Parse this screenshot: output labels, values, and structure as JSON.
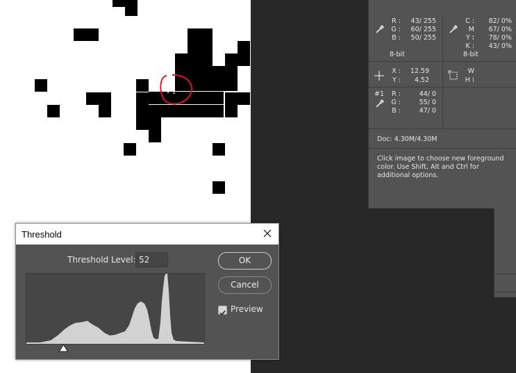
{
  "canvas": {
    "background": "#ffffff",
    "pixel_color": "#000000",
    "marker_color": "#e0141e"
  },
  "info_panel": {
    "rgb_primary": {
      "labels": [
        "R :",
        "G :",
        "B :"
      ],
      "values": [
        "43/  255",
        "60/  255",
        "50/  255"
      ],
      "bit": "8-bit"
    },
    "cmyk": {
      "labels": [
        "C :",
        "M :",
        "Y :",
        "K :"
      ],
      "values": [
        "82/    0%",
        "67/    0%",
        "78/    0%",
        "43/    0%"
      ],
      "bit": "8-bit"
    },
    "position": {
      "labels": [
        "X :",
        "Y :"
      ],
      "values": [
        "12.59",
        "4.52"
      ]
    },
    "size": {
      "labels": [
        "W :",
        "H :"
      ]
    },
    "sampler": {
      "id": "#1",
      "labels": [
        "R :",
        "G :",
        "B :"
      ],
      "values": [
        "44/    0",
        "55/    0",
        "47/    0"
      ]
    },
    "doc": "Doc: 4.30M/4.30M",
    "help": "Click image to choose new foreground color.  Use Shift, Alt and Ctrl for additional options."
  },
  "dialog": {
    "title": "Threshold",
    "threshold_label": "Threshold Level:",
    "threshold_value": "52",
    "ok_label": "OK",
    "cancel_label": "Cancel",
    "preview_label": "Preview",
    "preview_checked": true,
    "slider_level": 52
  }
}
